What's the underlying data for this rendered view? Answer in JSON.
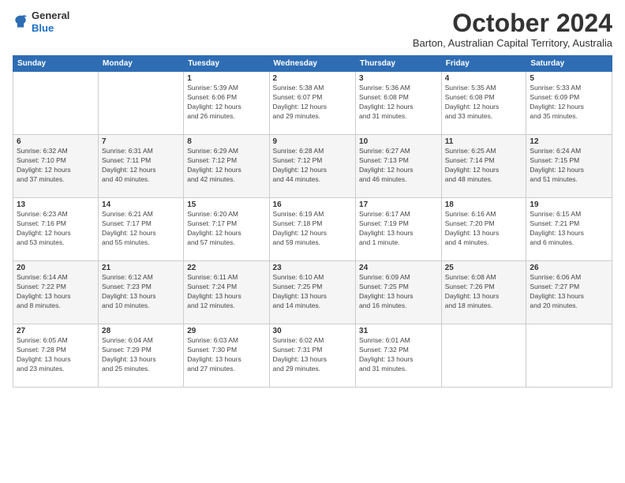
{
  "logo": {
    "general": "General",
    "blue": "Blue"
  },
  "header": {
    "title": "October 2024",
    "location": "Barton, Australian Capital Territory, Australia"
  },
  "weekdays": [
    "Sunday",
    "Monday",
    "Tuesday",
    "Wednesday",
    "Thursday",
    "Friday",
    "Saturday"
  ],
  "weeks": [
    [
      {
        "day": "",
        "detail": ""
      },
      {
        "day": "",
        "detail": ""
      },
      {
        "day": "1",
        "detail": "Sunrise: 5:39 AM\nSunset: 6:06 PM\nDaylight: 12 hours\nand 26 minutes."
      },
      {
        "day": "2",
        "detail": "Sunrise: 5:38 AM\nSunset: 6:07 PM\nDaylight: 12 hours\nand 29 minutes."
      },
      {
        "day": "3",
        "detail": "Sunrise: 5:36 AM\nSunset: 6:08 PM\nDaylight: 12 hours\nand 31 minutes."
      },
      {
        "day": "4",
        "detail": "Sunrise: 5:35 AM\nSunset: 6:08 PM\nDaylight: 12 hours\nand 33 minutes."
      },
      {
        "day": "5",
        "detail": "Sunrise: 5:33 AM\nSunset: 6:09 PM\nDaylight: 12 hours\nand 35 minutes."
      }
    ],
    [
      {
        "day": "6",
        "detail": "Sunrise: 6:32 AM\nSunset: 7:10 PM\nDaylight: 12 hours\nand 37 minutes."
      },
      {
        "day": "7",
        "detail": "Sunrise: 6:31 AM\nSunset: 7:11 PM\nDaylight: 12 hours\nand 40 minutes."
      },
      {
        "day": "8",
        "detail": "Sunrise: 6:29 AM\nSunset: 7:12 PM\nDaylight: 12 hours\nand 42 minutes."
      },
      {
        "day": "9",
        "detail": "Sunrise: 6:28 AM\nSunset: 7:12 PM\nDaylight: 12 hours\nand 44 minutes."
      },
      {
        "day": "10",
        "detail": "Sunrise: 6:27 AM\nSunset: 7:13 PM\nDaylight: 12 hours\nand 46 minutes."
      },
      {
        "day": "11",
        "detail": "Sunrise: 6:25 AM\nSunset: 7:14 PM\nDaylight: 12 hours\nand 48 minutes."
      },
      {
        "day": "12",
        "detail": "Sunrise: 6:24 AM\nSunset: 7:15 PM\nDaylight: 12 hours\nand 51 minutes."
      }
    ],
    [
      {
        "day": "13",
        "detail": "Sunrise: 6:23 AM\nSunset: 7:16 PM\nDaylight: 12 hours\nand 53 minutes."
      },
      {
        "day": "14",
        "detail": "Sunrise: 6:21 AM\nSunset: 7:17 PM\nDaylight: 12 hours\nand 55 minutes."
      },
      {
        "day": "15",
        "detail": "Sunrise: 6:20 AM\nSunset: 7:17 PM\nDaylight: 12 hours\nand 57 minutes."
      },
      {
        "day": "16",
        "detail": "Sunrise: 6:19 AM\nSunset: 7:18 PM\nDaylight: 12 hours\nand 59 minutes."
      },
      {
        "day": "17",
        "detail": "Sunrise: 6:17 AM\nSunset: 7:19 PM\nDaylight: 13 hours\nand 1 minute."
      },
      {
        "day": "18",
        "detail": "Sunrise: 6:16 AM\nSunset: 7:20 PM\nDaylight: 13 hours\nand 4 minutes."
      },
      {
        "day": "19",
        "detail": "Sunrise: 6:15 AM\nSunset: 7:21 PM\nDaylight: 13 hours\nand 6 minutes."
      }
    ],
    [
      {
        "day": "20",
        "detail": "Sunrise: 6:14 AM\nSunset: 7:22 PM\nDaylight: 13 hours\nand 8 minutes."
      },
      {
        "day": "21",
        "detail": "Sunrise: 6:12 AM\nSunset: 7:23 PM\nDaylight: 13 hours\nand 10 minutes."
      },
      {
        "day": "22",
        "detail": "Sunrise: 6:11 AM\nSunset: 7:24 PM\nDaylight: 13 hours\nand 12 minutes."
      },
      {
        "day": "23",
        "detail": "Sunrise: 6:10 AM\nSunset: 7:25 PM\nDaylight: 13 hours\nand 14 minutes."
      },
      {
        "day": "24",
        "detail": "Sunrise: 6:09 AM\nSunset: 7:25 PM\nDaylight: 13 hours\nand 16 minutes."
      },
      {
        "day": "25",
        "detail": "Sunrise: 6:08 AM\nSunset: 7:26 PM\nDaylight: 13 hours\nand 18 minutes."
      },
      {
        "day": "26",
        "detail": "Sunrise: 6:06 AM\nSunset: 7:27 PM\nDaylight: 13 hours\nand 20 minutes."
      }
    ],
    [
      {
        "day": "27",
        "detail": "Sunrise: 6:05 AM\nSunset: 7:28 PM\nDaylight: 13 hours\nand 23 minutes."
      },
      {
        "day": "28",
        "detail": "Sunrise: 6:04 AM\nSunset: 7:29 PM\nDaylight: 13 hours\nand 25 minutes."
      },
      {
        "day": "29",
        "detail": "Sunrise: 6:03 AM\nSunset: 7:30 PM\nDaylight: 13 hours\nand 27 minutes."
      },
      {
        "day": "30",
        "detail": "Sunrise: 6:02 AM\nSunset: 7:31 PM\nDaylight: 13 hours\nand 29 minutes."
      },
      {
        "day": "31",
        "detail": "Sunrise: 6:01 AM\nSunset: 7:32 PM\nDaylight: 13 hours\nand 31 minutes."
      },
      {
        "day": "",
        "detail": ""
      },
      {
        "day": "",
        "detail": ""
      }
    ]
  ]
}
